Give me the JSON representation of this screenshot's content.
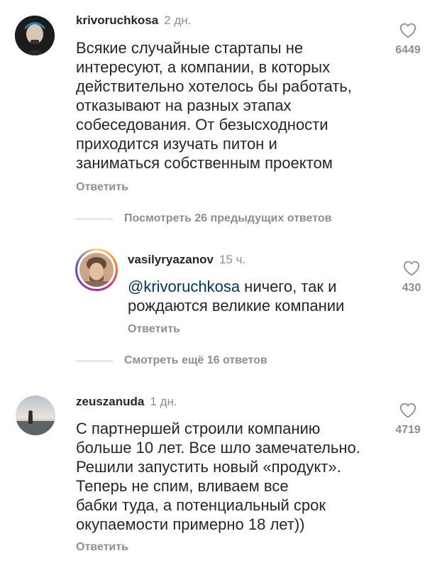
{
  "comments": [
    {
      "username": "krivoruchkosa",
      "time": "2 дн.",
      "text": "Всякие случайные стартапы не\nинтересуют, а компании, в которых\nдействительно хотелось бы работать,\nотказывают на разных этапах\nсобеседования.  От безысходности\nприходится изучать питон и\nзаниматься собственным проектом",
      "reply_label": "Ответить",
      "likes": "6449"
    },
    {
      "username": "zeuszanuda",
      "time": "1 дн.",
      "text": "С партнершей строили компанию\nбольше 10 лет. Все шло замечательно.\nРешили запустить новый «продукт».\nТеперь не спим, вливаем все\nбабки туда, а потенциальный срок\nокупаемости примерно 18 лет))",
      "reply_label": "Ответить",
      "likes": "4719"
    }
  ],
  "view_previous_replies": "Посмотреть 26 предыдущих ответов",
  "reply": {
    "username": "vasilyryazanov",
    "time": "15 ч.",
    "mention": "@krivoruchkosa",
    "text": " ничего, так и\nрождаются великие компании",
    "reply_label": "Ответить",
    "likes": "430"
  },
  "view_more_replies": "Смотреть ещё 16 ответов",
  "icons": [
    "heart-icon"
  ],
  "colors": {
    "text": "#262626",
    "secondary": "#8e8e8e",
    "mention": "#00376b",
    "story_ring": "#c13584"
  }
}
